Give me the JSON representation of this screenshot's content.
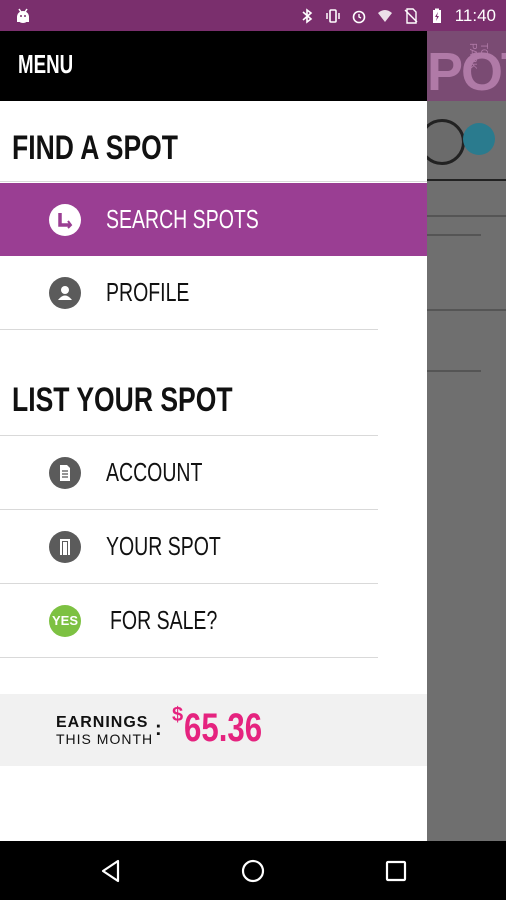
{
  "status_bar": {
    "time": "11:40",
    "icons": [
      "android-icon",
      "bluetooth-icon",
      "vibrate-icon",
      "alarm-icon",
      "wifi-icon",
      "no-sim-icon",
      "battery-charging-icon"
    ]
  },
  "background_app": {
    "title": "POT",
    "subtitle": "TO PARK"
  },
  "drawer": {
    "menu_title": "MENU",
    "find_section": {
      "title": "FIND A SPOT",
      "items": [
        {
          "label": "SEARCH SPOTS",
          "icon": "search-spots-icon",
          "active": true
        },
        {
          "label": "PROFILE",
          "icon": "profile-icon",
          "active": false
        }
      ]
    },
    "list_section": {
      "title": "LIST YOUR SPOT",
      "items": [
        {
          "label": "ACCOUNT",
          "icon": "document-icon"
        },
        {
          "label": "YOUR SPOT",
          "icon": "door-icon"
        },
        {
          "label": "FOR SALE?",
          "icon": "yes-badge-icon",
          "badge": "YES"
        }
      ]
    },
    "earnings": {
      "label_line1": "EARNINGS",
      "label_line2": "THIS MONTH",
      "colon": ":",
      "currency": "$",
      "amount": "65.36"
    }
  },
  "colors": {
    "accent": "#9a3e93",
    "status_bar": "#7a2f6d",
    "earnings_pink": "#e5237f",
    "yes_green": "#7dc142"
  },
  "nav_bar": {
    "buttons": [
      "back-icon",
      "home-icon",
      "recents-icon"
    ]
  }
}
